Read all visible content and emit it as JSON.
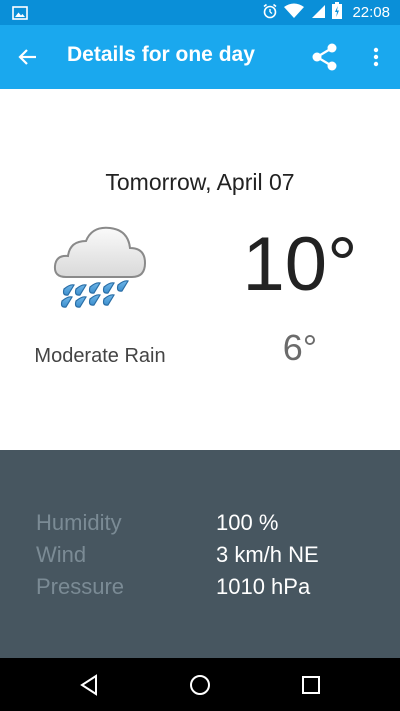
{
  "status_bar": {
    "time": "22:08",
    "icons": [
      "image-icon",
      "alarm-icon",
      "wifi-icon",
      "signal-icon",
      "battery-icon"
    ],
    "color": "#0a8fd8"
  },
  "app_bar": {
    "title": "Details for one day",
    "back_icon": "back-arrow-icon",
    "share_icon": "share-icon",
    "overflow_icon": "more-vert-icon",
    "color": "#1aa8ee"
  },
  "forecast": {
    "date": "Tomorrow, April 07",
    "condition": "Moderate Rain",
    "condition_icon": "rain-cloud-icon",
    "high": "10°",
    "low": "6°"
  },
  "details": {
    "background": "#475660",
    "rows": [
      {
        "label": "Humidity",
        "value": "100 %"
      },
      {
        "label": "Wind",
        "value": "3 km/h NE"
      },
      {
        "label": "Pressure",
        "value": "1010 hPa"
      }
    ]
  },
  "nav_bar": {
    "buttons": [
      "back-triangle-icon",
      "home-circle-icon",
      "recents-square-icon"
    ]
  }
}
